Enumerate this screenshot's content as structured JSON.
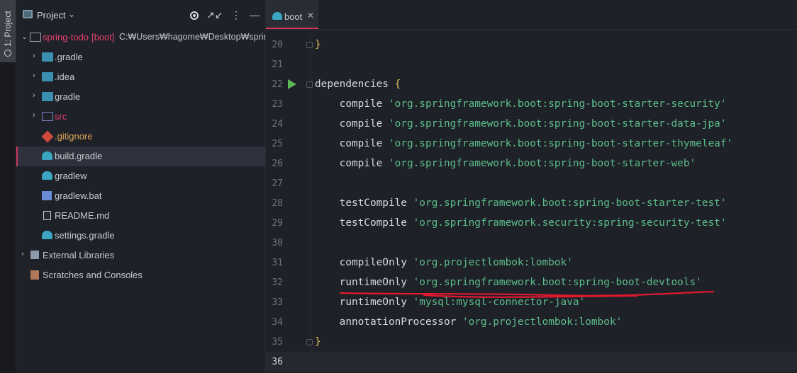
{
  "sidebar_stripe": {
    "label": "1: Project"
  },
  "project_panel": {
    "title": "Project",
    "tree": [
      {
        "name": "spring-todo",
        "suffix": "[boot]",
        "path": "C:₩Users₩hagome₩Desktop₩spring-t",
        "icon": "folder-icon",
        "expanded": true
      },
      {
        "name": ".gradle",
        "icon": "folder-icon"
      },
      {
        "name": ".idea",
        "icon": "folder-icon"
      },
      {
        "name": "gradle",
        "icon": "folder-icon"
      },
      {
        "name": "src",
        "icon": "source-folder-icon"
      },
      {
        "name": ".gitignore",
        "icon": "git-icon"
      },
      {
        "name": "build.gradle",
        "icon": "gradle-icon"
      },
      {
        "name": "gradlew",
        "icon": "gradle-icon"
      },
      {
        "name": "gradlew.bat",
        "icon": "windows-icon"
      },
      {
        "name": "README.md",
        "icon": "markdown-icon"
      },
      {
        "name": "settings.gradle",
        "icon": "gradle-icon"
      },
      {
        "name": "External Libraries",
        "icon": "library-icon"
      },
      {
        "name": "Scratches and Consoles",
        "icon": "scratches-icon"
      }
    ]
  },
  "editor": {
    "tab_label": "boot",
    "lines": [
      {
        "num": "20"
      },
      {
        "num": "21"
      },
      {
        "num": "22"
      },
      {
        "num": "23"
      },
      {
        "num": "24"
      },
      {
        "num": "25"
      },
      {
        "num": "26"
      },
      {
        "num": "27"
      },
      {
        "num": "28"
      },
      {
        "num": "29"
      },
      {
        "num": "30"
      },
      {
        "num": "31"
      },
      {
        "num": "32"
      },
      {
        "num": "33"
      },
      {
        "num": "34"
      },
      {
        "num": "35"
      },
      {
        "num": "36"
      }
    ],
    "code": {
      "l20": "}",
      "l22_kw": "dependencies ",
      "l22_brace": "{",
      "l23_kw": "    compile ",
      "l23_str": "'org.springframework.boot:spring-boot-starter-security'",
      "l24_kw": "    compile ",
      "l24_str": "'org.springframework.boot:spring-boot-starter-data-jpa'",
      "l25_kw": "    compile ",
      "l25_str": "'org.springframework.boot:spring-boot-starter-thymeleaf'",
      "l26_kw": "    compile ",
      "l26_str": "'org.springframework.boot:spring-boot-starter-web'",
      "l28_kw": "    testCompile ",
      "l28_str": "'org.springframework.boot:spring-boot-starter-test'",
      "l29_kw": "    testCompile ",
      "l29_str": "'org.springframework.security:spring-security-test'",
      "l31_kw": "    compileOnly ",
      "l31_str": "'org.projectlombok:lombok'",
      "l32_kw": "    runtimeOnly ",
      "l32_str": "'org.springframework.boot:spring-boot-devtools'",
      "l33_kw": "    runtimeOnly ",
      "l33_str": "'mysql:mysql-connector-java'",
      "l34_kw": "    annotationProcessor ",
      "l34_str": "'org.projectlombok:lombok'",
      "l35": "}"
    }
  },
  "colors": {
    "accent": "#d0335a",
    "string": "#5bbd8a",
    "annotation_underline": "#e0192f"
  }
}
